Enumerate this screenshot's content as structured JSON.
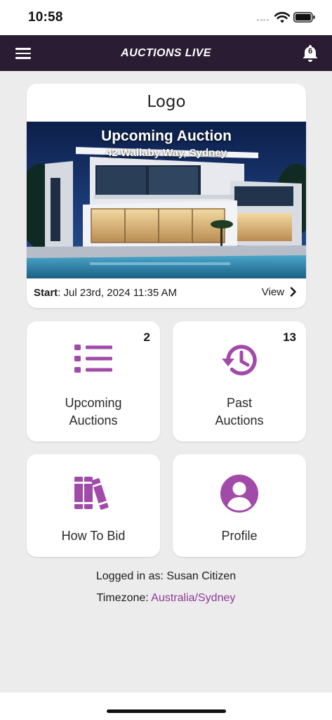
{
  "status_bar": {
    "time": "10:58"
  },
  "header": {
    "title": "AUCTIONS LIVE",
    "notification_count": "6"
  },
  "featured": {
    "logo_text": "Logo",
    "title": "Upcoming Auction",
    "address": "42 Wallaby Way, Sydney",
    "start_label": "Start",
    "start_value": ": Jul 23rd, 2024 11:35 AM",
    "view_label": "View"
  },
  "tiles": [
    {
      "label": "Upcoming Auctions",
      "count": "2",
      "icon": "list-icon"
    },
    {
      "label": "Past Auctions",
      "count": "13",
      "icon": "history-icon"
    },
    {
      "label": "How To Bid",
      "icon": "books-icon"
    },
    {
      "label": "Profile",
      "icon": "account-circle-icon"
    }
  ],
  "footer": {
    "logged_in_label": "Logged in as: Susan Citizen",
    "timezone_label": "Timezone: ",
    "timezone_value": "Australia/Sydney"
  },
  "colors": {
    "app_bar": "#2a1c33",
    "accent": "#a24aa9",
    "link": "#8e3a97",
    "background": "#ececec"
  }
}
